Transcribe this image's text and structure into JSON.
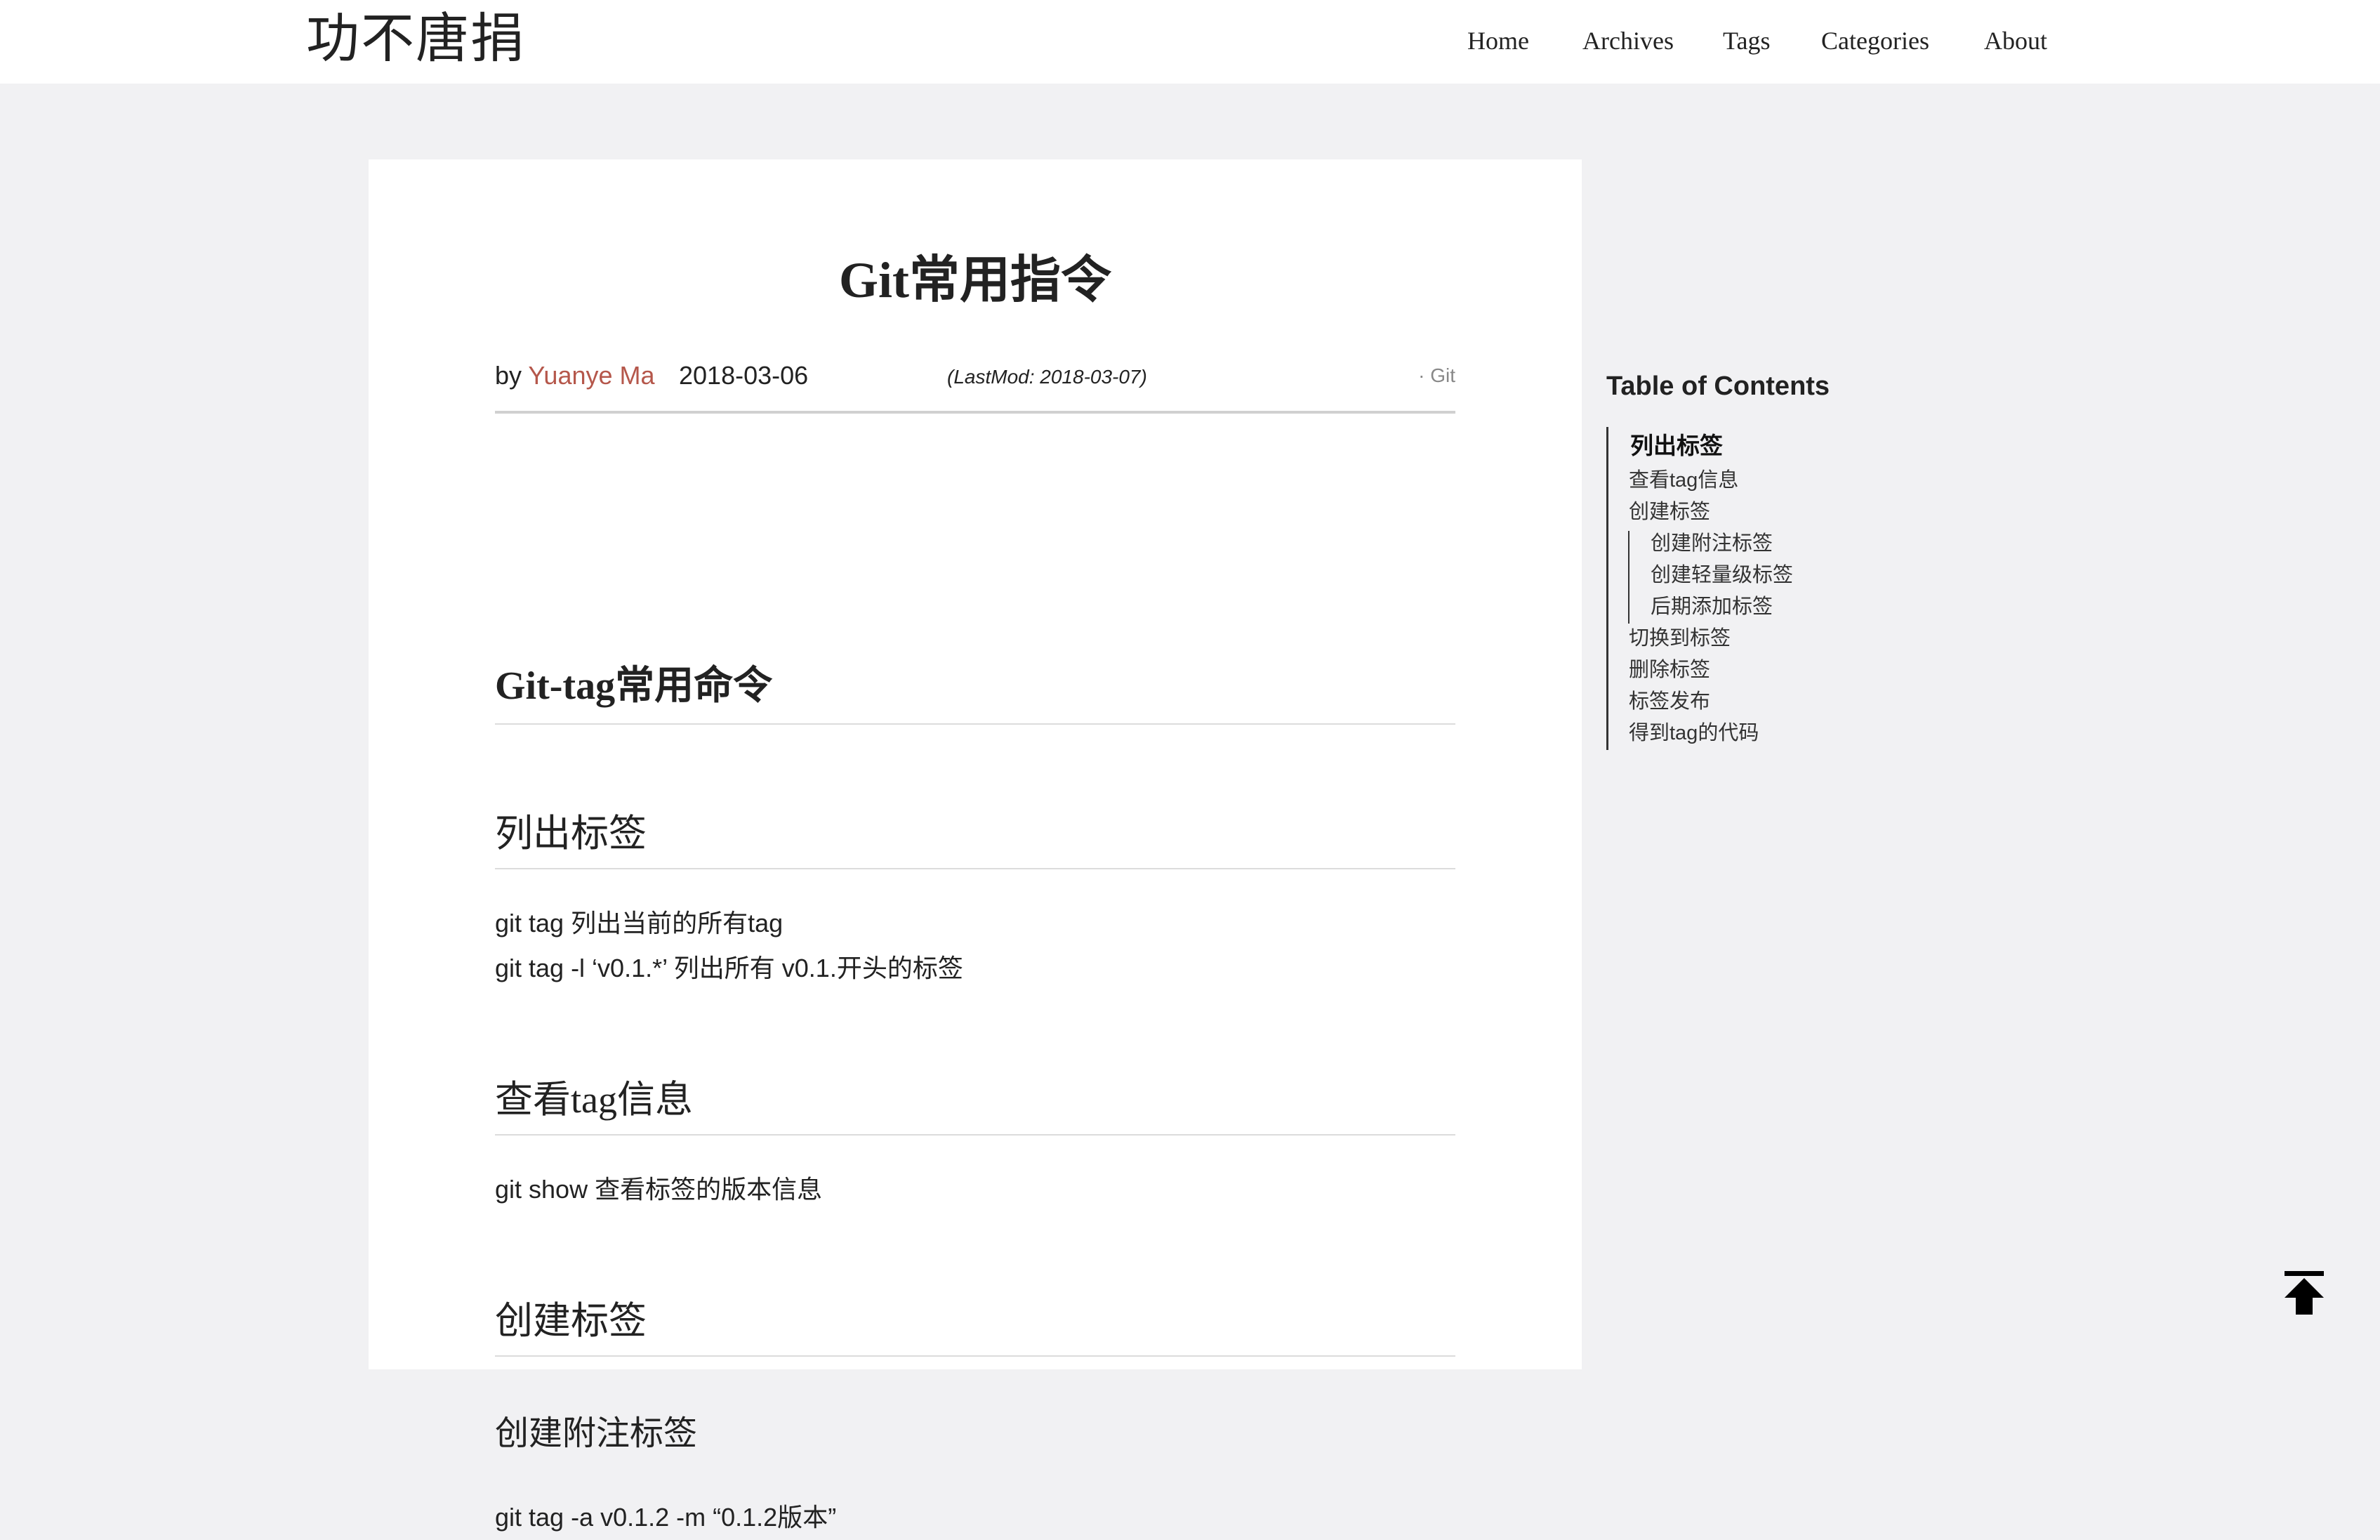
{
  "site": {
    "title": "功不唐捐"
  },
  "nav": [
    "Home",
    "Archives",
    "Tags",
    "Categories",
    "About"
  ],
  "post": {
    "title": "Git常用指令",
    "meta": {
      "by": "by",
      "author": "Yuanye Ma",
      "date": "2018-03-06",
      "lastmod": "(LastMod: 2018-03-07)",
      "category": "· Git"
    },
    "sections": {
      "h1": "Git-tag常用命令",
      "list_heading": "列出标签",
      "list_lines": [
        "git tag 列出当前的所有tag",
        "git tag -l ‘v0.1.*’ 列出所有 v0.1.开头的标签"
      ],
      "show_heading": "查看tag信息",
      "show_line": "git show 查看标签的版本信息",
      "create_heading": "创建标签",
      "annotated_heading": "创建附注标签",
      "annotated_line": "git tag -a v0.1.2 -m “0.1.2版本”"
    }
  },
  "toc": {
    "title": "Table of Contents",
    "items": [
      {
        "label": "列出标签",
        "level": 1,
        "active": true
      },
      {
        "label": "查看tag信息",
        "level": 1
      },
      {
        "label": "创建标签",
        "level": 1
      },
      {
        "label": "创建附注标签",
        "level": 2
      },
      {
        "label": "创建轻量级标签",
        "level": 2
      },
      {
        "label": "后期添加标签",
        "level": 2
      },
      {
        "label": "切换到标签",
        "level": 1
      },
      {
        "label": "删除标签",
        "level": 1
      },
      {
        "label": "标签发布",
        "level": 1
      },
      {
        "label": "得到tag的代码",
        "level": 1
      }
    ]
  },
  "icons": {
    "back_to_top": "arrow-to-top-icon"
  },
  "colors": {
    "accent": "#b5574b",
    "background": "#f1f1f3",
    "card": "#ffffff"
  }
}
